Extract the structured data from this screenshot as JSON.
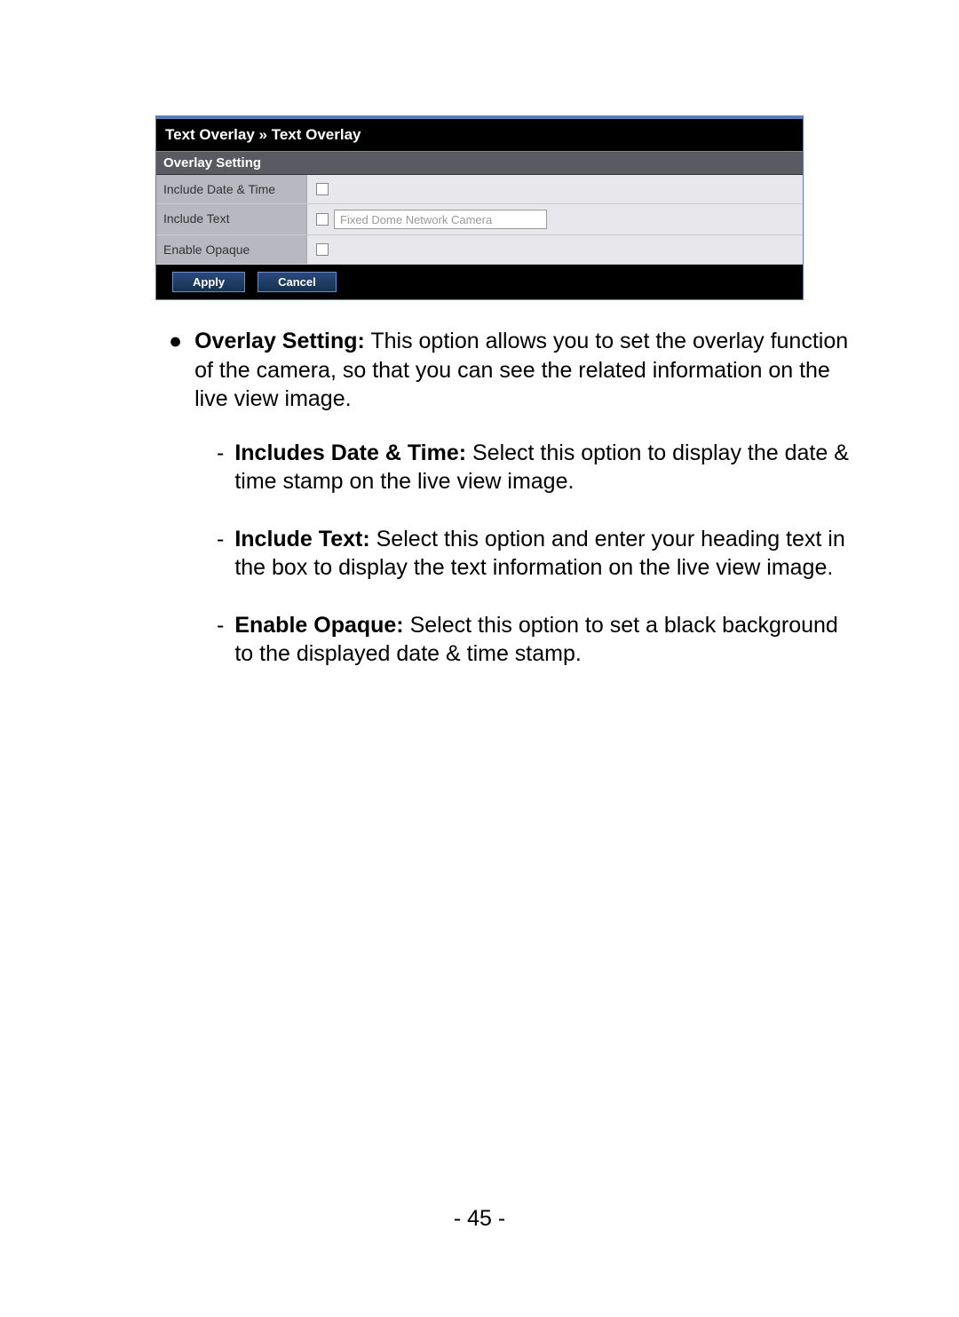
{
  "panel": {
    "breadcrumb": "Text Overlay » Text Overlay",
    "section_title": "Overlay Setting",
    "rows": {
      "row0_label": "Include Date & Time",
      "row1_label": "Include Text",
      "row1_input_value": "Fixed Dome Network Camera",
      "row2_label": "Enable Opaque"
    },
    "buttons": {
      "apply": "Apply",
      "cancel": "Cancel"
    }
  },
  "description": {
    "main_label": "Overlay Setting:",
    "main_text": " This option allows you to set the overlay function of the camera, so that you can see the related information on the live view image.",
    "sub1_label": "Includes Date & Time:",
    "sub1_text": " Select this option to display the date & time stamp on the live view image.",
    "sub2_label": "Include Text:",
    "sub2_text": " Select this option and enter your heading text in the box to display the text information on the live view image.",
    "sub3_label": "Enable Opaque:",
    "sub3_text": " Select this option to set a black background to the displayed date & time stamp."
  },
  "page_number": "- 45 -"
}
